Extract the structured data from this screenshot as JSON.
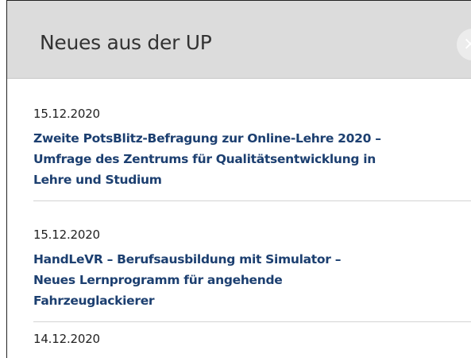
{
  "panel": {
    "title": "Neues aus der UP",
    "close_icon_glyph": "×",
    "colors": {
      "header_bg": "#dcdcdc",
      "title_link": "#1c3f70",
      "divider": "#d3d3d3"
    }
  },
  "news": [
    {
      "date": "15.12.2020",
      "title": "Zweite PotsBlitz-Befragung zur Online-Lehre 2020 –\nUmfrage des Zentrums für Qualitätsentwicklung in\nLehre und Studium"
    },
    {
      "date": "15.12.2020",
      "title": "HandLeVR – Berufsausbildung mit Simulator –\nNeues Lernprogramm für angehende\nFahrzeuglackierer"
    },
    {
      "date": "14.12.2020"
    }
  ]
}
